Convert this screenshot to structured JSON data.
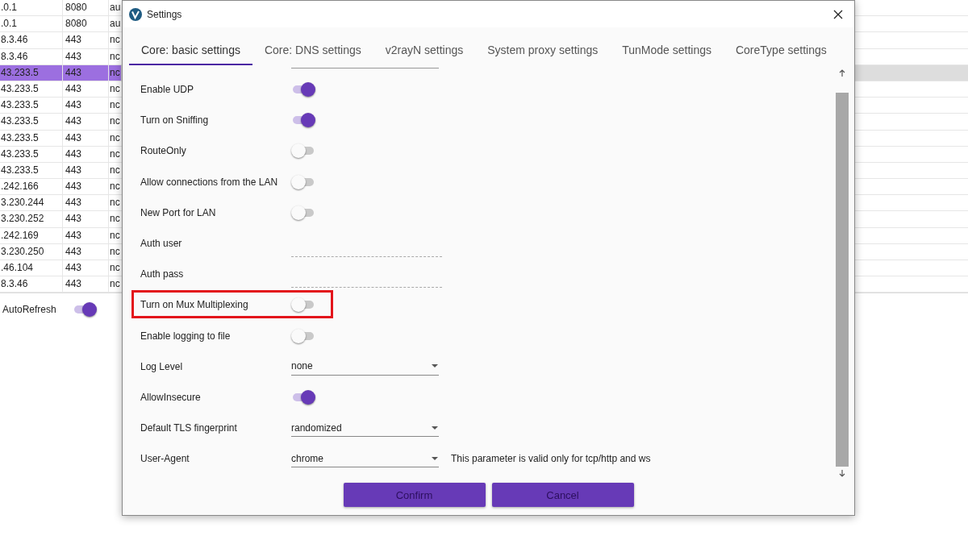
{
  "background_table": {
    "rows": [
      {
        "column_1": ".0.1",
        "column_2": "8080",
        "column_3": "au",
        "selected": false
      },
      {
        "column_1": ".0.1",
        "column_2": "8080",
        "column_3": "au",
        "selected": false
      },
      {
        "column_1": "8.3.46",
        "column_2": "443",
        "column_3": "nc",
        "selected": false
      },
      {
        "column_1": "8.3.46",
        "column_2": "443",
        "column_3": "nc",
        "selected": false
      },
      {
        "column_1": "43.233.5",
        "column_2": "443",
        "column_3": "nc",
        "selected": true
      },
      {
        "column_1": "43.233.5",
        "column_2": "443",
        "column_3": "nc",
        "selected": false
      },
      {
        "column_1": "43.233.5",
        "column_2": "443",
        "column_3": "nc",
        "selected": false
      },
      {
        "column_1": "43.233.5",
        "column_2": "443",
        "column_3": "nc",
        "selected": false
      },
      {
        "column_1": "43.233.5",
        "column_2": "443",
        "column_3": "nc",
        "selected": false
      },
      {
        "column_1": "43.233.5",
        "column_2": "443",
        "column_3": "nc",
        "selected": false
      },
      {
        "column_1": "43.233.5",
        "column_2": "443",
        "column_3": "nc",
        "selected": false
      },
      {
        "column_1": ".242.166",
        "column_2": "443",
        "column_3": "nc",
        "selected": false
      },
      {
        "column_1": "3.230.244",
        "column_2": "443",
        "column_3": "nc",
        "selected": false
      },
      {
        "column_1": "3.230.252",
        "column_2": "443",
        "column_3": "nc",
        "selected": false
      },
      {
        "column_1": ".242.169",
        "column_2": "443",
        "column_3": "nc",
        "selected": false
      },
      {
        "column_1": "3.230.250",
        "column_2": "443",
        "column_3": "nc",
        "selected": false
      },
      {
        "column_1": ".46.104",
        "column_2": "443",
        "column_3": "nc",
        "selected": false
      },
      {
        "column_1": "8.3.46",
        "column_2": "443",
        "column_3": "nc",
        "selected": false
      }
    ]
  },
  "auto_refresh": {
    "label": "AutoRefresh",
    "on": true
  },
  "dialog": {
    "title": "Settings",
    "tabs": [
      {
        "label": "Core: basic settings",
        "selected": true
      },
      {
        "label": "Core: DNS settings",
        "selected": false
      },
      {
        "label": "v2rayN settings",
        "selected": false
      },
      {
        "label": "System proxy settings",
        "selected": false
      },
      {
        "label": "TunMode settings",
        "selected": false
      },
      {
        "label": "CoreType settings",
        "selected": false
      }
    ],
    "settings": [
      {
        "kind": "toggle",
        "label": "Enable UDP",
        "on": true,
        "highlighted": false
      },
      {
        "kind": "toggle",
        "label": "Turn on Sniffing",
        "on": true,
        "highlighted": false
      },
      {
        "kind": "toggle",
        "label": "RouteOnly",
        "on": false,
        "highlighted": false
      },
      {
        "kind": "toggle",
        "label": "Allow connections from the LAN",
        "on": false,
        "highlighted": false
      },
      {
        "kind": "toggle",
        "label": "New Port for LAN",
        "on": false,
        "highlighted": false
      },
      {
        "kind": "text",
        "label": "Auth user",
        "highlighted": false
      },
      {
        "kind": "text",
        "label": "Auth pass",
        "highlighted": false
      },
      {
        "kind": "toggle",
        "label": "Turn on Mux Multiplexing",
        "on": false,
        "highlighted": true
      },
      {
        "kind": "toggle",
        "label": "Enable logging to file",
        "on": false,
        "highlighted": false
      },
      {
        "kind": "select",
        "label": "Log Level",
        "value": "none",
        "highlighted": false
      },
      {
        "kind": "toggle",
        "label": "AllowInsecure",
        "on": true,
        "highlighted": false
      },
      {
        "kind": "select",
        "label": "Default TLS fingerprint",
        "value": "randomized",
        "highlighted": false
      },
      {
        "kind": "select",
        "label": "User-Agent",
        "value": "chrome",
        "note": "This parameter is valid only for tcp/http and ws",
        "highlighted": false
      }
    ],
    "buttons": [
      {
        "label": "Confirm"
      },
      {
        "label": "Cancel"
      }
    ]
  }
}
